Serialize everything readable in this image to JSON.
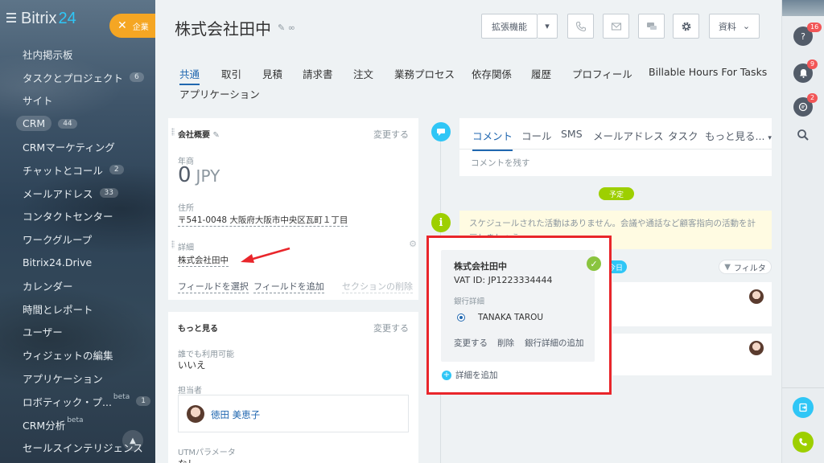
{
  "sidebar": {
    "logo_main": "Bitrix",
    "logo_num": "24",
    "company_button": "企業",
    "items": [
      {
        "label": "社内掲示板",
        "badge": ""
      },
      {
        "label": "タスクとプロジェクト",
        "badge": "6"
      },
      {
        "label": "サイト",
        "badge": ""
      },
      {
        "label": "CRM",
        "badge": "44"
      },
      {
        "label": "CRMマーケティング",
        "badge": ""
      },
      {
        "label": "チャットとコール",
        "badge": "2"
      },
      {
        "label": "メールアドレス",
        "badge": "33"
      },
      {
        "label": "コンタクトセンター",
        "badge": ""
      },
      {
        "label": "ワークグループ",
        "badge": ""
      },
      {
        "label": "Bitrix24.Drive",
        "badge": ""
      },
      {
        "label": "カレンダー",
        "badge": ""
      },
      {
        "label": "時間とレポート",
        "badge": ""
      },
      {
        "label": "ユーザー",
        "badge": ""
      },
      {
        "label": "ウィジェットの編集",
        "badge": ""
      },
      {
        "label": "アプリケーション",
        "badge": ""
      },
      {
        "label": "ロボティック・プ...",
        "badge": "1",
        "sup": "beta"
      },
      {
        "label": "CRM分析",
        "badge": "",
        "sup": "beta"
      },
      {
        "label": "セールスインテリジェンス",
        "badge": ""
      }
    ]
  },
  "header": {
    "title": "株式会社田中",
    "ext_button": "拡張機能",
    "docs_button": "資料"
  },
  "tabs": [
    "共通",
    "取引",
    "見積",
    "請求書",
    "注文",
    "業務プロセス",
    "依存関係",
    "履歴",
    "プロフィール",
    "Billable Hours For Tasks",
    "アプリケーション"
  ],
  "left_card": {
    "section_title": "会社概要",
    "change": "変更する",
    "revenue_label": "年商",
    "revenue_value": "0",
    "revenue_currency": "JPY",
    "address_label": "住所",
    "address_value": "〒541-0048 大阪府大阪市中央区瓦町１丁目",
    "details_label": "詳細",
    "details_value": "株式会社田中",
    "select_field": "フィールドを選択",
    "add_field": "フィールドを追加",
    "delete_section": "セクションの削除"
  },
  "more_card": {
    "title": "もっと見る",
    "change": "変更する",
    "available_label": "誰でも利用可能",
    "available_value": "いいえ",
    "responsible_label": "担当者",
    "responsible_name": "徳田 美恵子",
    "utm_label": "UTMパラメータ",
    "utm_value": "なし"
  },
  "activity": {
    "tabs": [
      "コメント",
      "コール",
      "SMS",
      "メールアドレス",
      "タスク",
      "もっと見る..."
    ],
    "placeholder": "コメントを残す",
    "planned_pill": "予定",
    "notice": "スケジュールされた活動はありません。会議や通話など顧客指向の活動を計画しましょう。",
    "today_pill": "今日",
    "filter": "フィルタ"
  },
  "popup": {
    "company": "株式会社田中",
    "vat": "VAT ID: JP1223334444",
    "bank_label": "銀行詳細",
    "bank_option": "TANAKA TAROU",
    "actions": [
      "変更する",
      "削除",
      "銀行詳細の追加"
    ],
    "add_detail": "詳細を追加"
  },
  "rail": {
    "badges": [
      "16",
      "9",
      "2"
    ]
  },
  "colors": {
    "accent": "#2067b0",
    "company_button": "#f5a623",
    "pill_green": "#9dcf00",
    "highlight_red": "#e9262b"
  }
}
